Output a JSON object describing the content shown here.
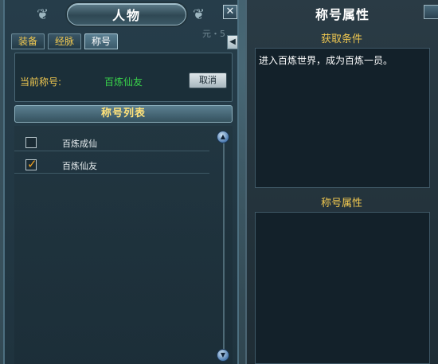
{
  "window": {
    "title": "人物",
    "close_label": "✕",
    "side_arrow_label": "◀",
    "ghost_text": "元・5"
  },
  "tabs": [
    {
      "label": "装备",
      "active": false
    },
    {
      "label": "经脉",
      "active": false
    },
    {
      "label": "称号",
      "active": true
    }
  ],
  "current_title": {
    "label": "当前称号:",
    "value": "百炼仙友",
    "cancel_label": "取消"
  },
  "title_list": {
    "header": "称号列表",
    "items": [
      {
        "label": "百炼成仙",
        "checked": false
      },
      {
        "label": "百炼仙友",
        "checked": true
      }
    ],
    "scroll_up_icon": "▲",
    "scroll_down_icon": "▼"
  },
  "attributes_panel": {
    "title": "称号属性",
    "condition_header": "获取条件",
    "condition_text": "进入百炼世界，成为百炼一员。",
    "attribute_header": "称号属性",
    "attribute_text": ""
  },
  "colors": {
    "accent_gold": "#f0c850",
    "active_green": "#39d34a"
  }
}
